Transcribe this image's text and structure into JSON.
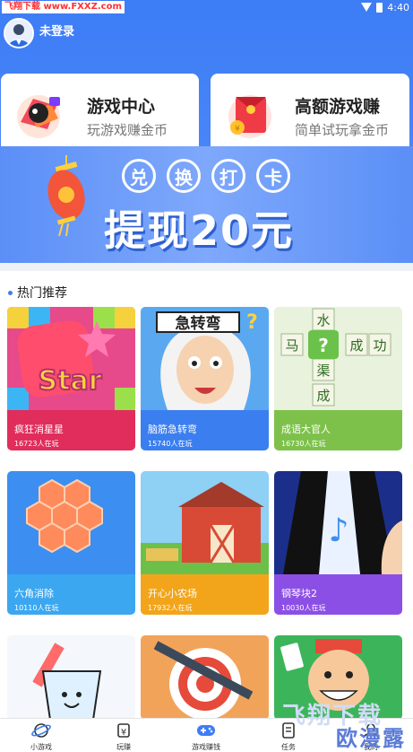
{
  "status": {
    "watermark": "飞翔下载 www.FXXZ.com",
    "time": "4:40"
  },
  "header": {
    "user_label": "未登录"
  },
  "cards": [
    {
      "title": "游戏中心",
      "subtitle": "玩游戏赚金币",
      "icon": "game-controller-icon"
    },
    {
      "title": "高额游戏赚",
      "subtitle": "简单试玩拿金币",
      "icon": "red-envelope-icon"
    }
  ],
  "banner": {
    "stamps": [
      "兑",
      "换",
      "打",
      "卡"
    ],
    "headline": "提现20元"
  },
  "section": {
    "title": "热门推荐"
  },
  "games": [
    {
      "name": "疯狂消星星",
      "players": "16723人在玩",
      "color": "#e02d5c",
      "art_text": "Star"
    },
    {
      "name": "脑筋急转弯",
      "players": "15740人在玩",
      "color": "#3b7ef0",
      "art_text": "急转弯"
    },
    {
      "name": "成语大官人",
      "players": "16730人在玩",
      "color": "#7dc14b",
      "art_text": "?"
    },
    {
      "name": "六角消除",
      "players": "10110人在玩",
      "color": "#3ba7f0",
      "art_text": ""
    },
    {
      "name": "开心小农场",
      "players": "17932人在玩",
      "color": "#f2a51a",
      "art_text": ""
    },
    {
      "name": "钢琴块2",
      "players": "10030人在玩",
      "color": "#8c4fe6",
      "art_text": ""
    }
  ],
  "nav": [
    {
      "label": "小游戏",
      "icon": "planet-icon"
    },
    {
      "label": "玩赚",
      "icon": "money-bag-icon"
    },
    {
      "label": "游戏赚钱",
      "icon": "gamepad-icon"
    },
    {
      "label": "任务",
      "icon": "task-icon"
    },
    {
      "label": "我的",
      "icon": "profile-icon"
    }
  ],
  "watermark_br": {
    "line1": "飞翔下载",
    "line2": "欧漫露"
  }
}
